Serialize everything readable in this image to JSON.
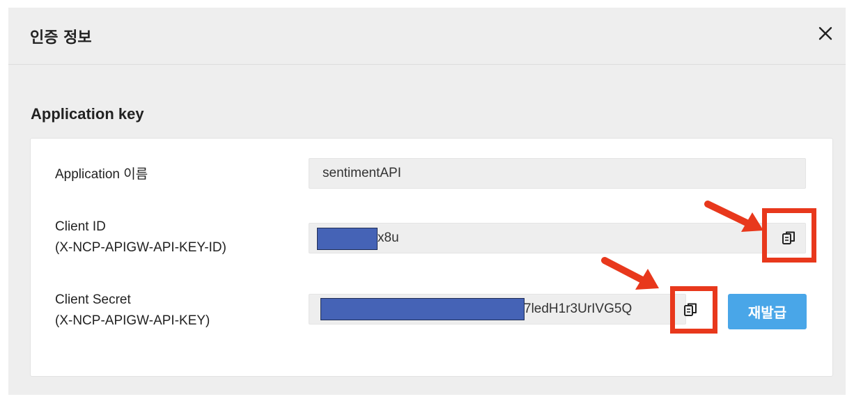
{
  "dialog": {
    "title": "인증 정보",
    "close_icon": "close-icon"
  },
  "section": {
    "title": "Application key"
  },
  "fields": {
    "app_name": {
      "label": "Application 이름",
      "value": "sentimentAPI"
    },
    "client_id": {
      "label": "Client ID",
      "sublabel": "(X-NCP-APIGW-API-KEY-ID)",
      "visible_suffix": "x8u",
      "copy_icon": "copy-icon"
    },
    "client_secret": {
      "label": "Client Secret",
      "sublabel": "(X-NCP-APIGW-API-KEY)",
      "visible_suffix": "7ledH1r3UrIVG5Q",
      "copy_icon": "copy-icon",
      "reissue_label": "재발급"
    }
  },
  "colors": {
    "redaction": "#4563b6",
    "highlight": "#e8381c",
    "button": "#49a6e8"
  }
}
